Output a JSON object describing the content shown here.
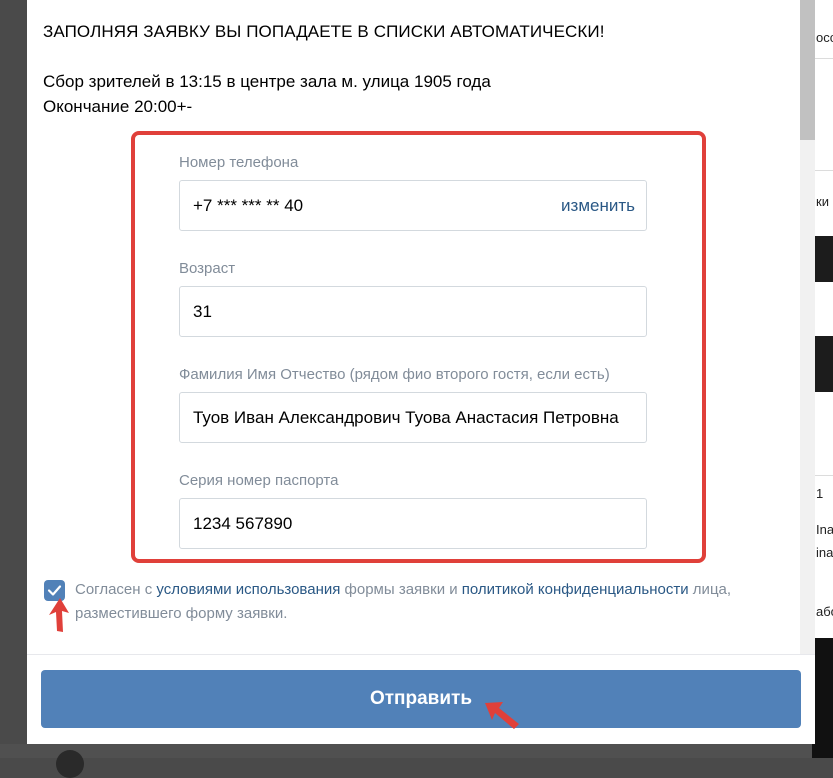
{
  "background": {
    "right_strip_texts": [
      "осси",
      "ки",
      "1",
      "Ina",
      "ina",
      "або"
    ]
  },
  "modal": {
    "headline": "ЗАПОЛНЯЯ ЗАЯВКУ ВЫ ПОПАДАЕТЕ В СПИСКИ АВТОМАТИЧЕСКИ!",
    "info_line_1": "Сбор зрителей в 13:15 в центре зала м. улица 1905 года",
    "info_line_2": "Окончание 20:00+-",
    "fields": [
      {
        "label": "Номер телефона",
        "value": "+7 *** *** ** 40",
        "action": "изменить"
      },
      {
        "label": "Возраст",
        "value": "31"
      },
      {
        "label": "Фамилия Имя Отчество (рядом фио второго гостя, если есть)",
        "value": "Туов Иван Александрович Туова Анастасия Петровна"
      },
      {
        "label": "Серия номер паспорта",
        "value": "1234 567890"
      }
    ],
    "consent": {
      "checked": true,
      "part_1": "Согласен с ",
      "link_1": "условиями использования",
      "part_2": " формы заявки и ",
      "link_2": "политикой конфиденциальности",
      "part_3": " лица, разместившего форму заявки."
    },
    "submit_label": "Отправить"
  },
  "colors": {
    "accent": "#5181b8",
    "link": "#2a5885",
    "muted": "#818c99",
    "highlight": "#e0403a"
  }
}
